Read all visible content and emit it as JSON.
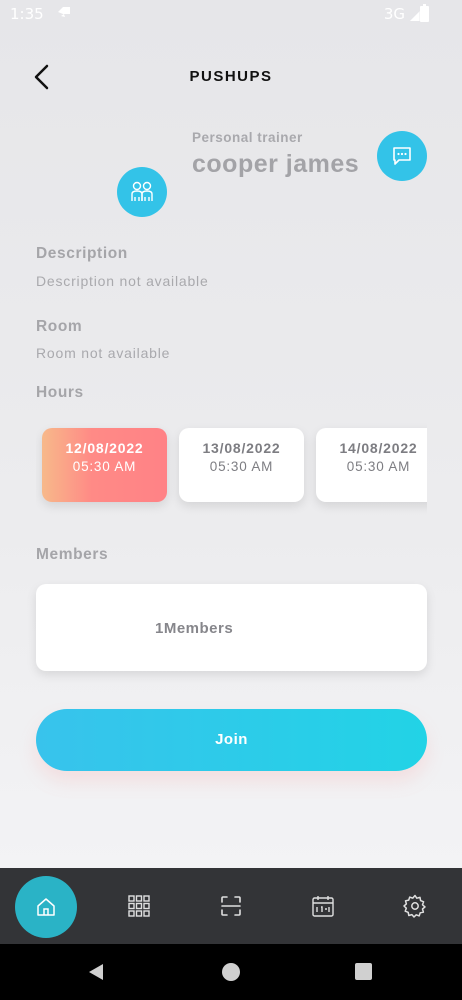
{
  "status_bar": {
    "time": "1:35",
    "network": "3G"
  },
  "header": {
    "title": "PUSHUPS"
  },
  "trainer": {
    "role": "Personal trainer",
    "name": "cooper james"
  },
  "description": {
    "label": "Description",
    "value": "Description not available"
  },
  "room": {
    "label": "Room",
    "value": "Room not available"
  },
  "hours": {
    "label": "Hours",
    "slots": [
      {
        "date": "12/08/2022",
        "time": "05:30 AM",
        "selected": true
      },
      {
        "date": "13/08/2022",
        "time": "05:30 AM",
        "selected": false
      },
      {
        "date": "14/08/2022",
        "time": "05:30 AM",
        "selected": false
      }
    ]
  },
  "members": {
    "label": "Members",
    "count_text": "1Members"
  },
  "join_button": {
    "label": "Join"
  },
  "colors": {
    "accent": "#33c3e8",
    "selected_slot_gradient_start": "#f7b98a",
    "selected_slot_gradient_end": "#ff8286",
    "nav_background": "#333437",
    "nav_home_active": "#2ab3c6"
  },
  "bottom_nav": {
    "items": [
      {
        "icon": "home-icon",
        "active": true
      },
      {
        "icon": "grid-icon",
        "active": false
      },
      {
        "icon": "scan-icon",
        "active": false
      },
      {
        "icon": "calendar-icon",
        "active": false
      },
      {
        "icon": "settings-icon",
        "active": false
      }
    ]
  }
}
